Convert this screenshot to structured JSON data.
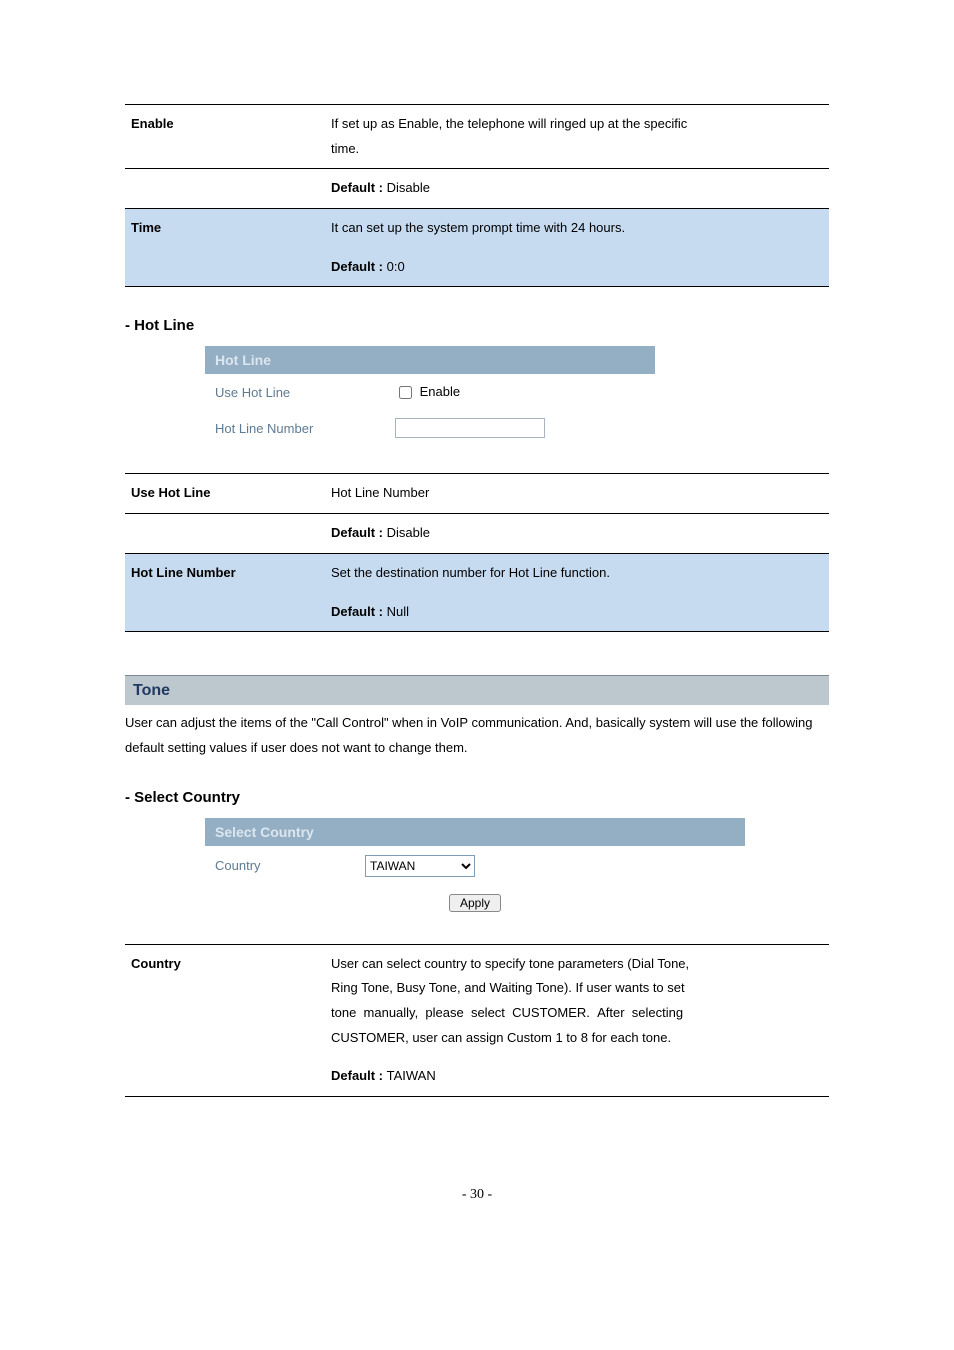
{
  "table1": {
    "r1_label": "Enable",
    "r1_desc_l1": "If set up as Enable, the telephone will ringed up at the specific",
    "r1_desc_l2": "time.",
    "r1_default_label": "Default : ",
    "r1_default_value": "Disable",
    "r2_label": "Time",
    "r2_desc": "It can set up the system prompt time with 24 hours.",
    "r2_default_label": "Default : ",
    "r2_default_value": "0:0"
  },
  "hotline_heading": "- Hot Line",
  "hotline_box": {
    "header": "Hot Line",
    "row1_label": "Use Hot Line",
    "row1_checkbox_label": "Enable",
    "row2_label": "Hot Line Number",
    "row2_value": ""
  },
  "table2": {
    "r1_label": "Use Hot Line",
    "r1_desc": "Hot Line Number",
    "r1_default_label": "Default : ",
    "r1_default_value": "Disable",
    "r2_label": "Hot Line Number",
    "r2_desc": "Set the destination number for Hot Line function.",
    "r2_default_label": "Default : ",
    "r2_default_value": "Null"
  },
  "tone_heading": "Tone",
  "tone_para": "User can adjust the items of the \"Call Control\" when in VoIP communication. And, basically system will use the following default setting values if user does not want to change them.",
  "select_country_heading": "- Select Country",
  "select_country_box": {
    "header": "Select Country",
    "row1_label": "Country",
    "row1_selected": "TAIWAN",
    "apply_label": "Apply"
  },
  "table3": {
    "r1_label": "Country",
    "r1_l1": "User can select country to specify tone parameters (Dial Tone,",
    "r1_l2": "Ring Tone, Busy Tone, and Waiting Tone). If user wants to set",
    "r1_l3": "tone  manually,  please  select  CUSTOMER.  After  selecting",
    "r1_l4": "CUSTOMER, user can assign Custom 1 to 8 for each tone.",
    "r1_default_label": "Default : ",
    "r1_default_value": "TAIWAN"
  },
  "page_number": "- 30 -"
}
